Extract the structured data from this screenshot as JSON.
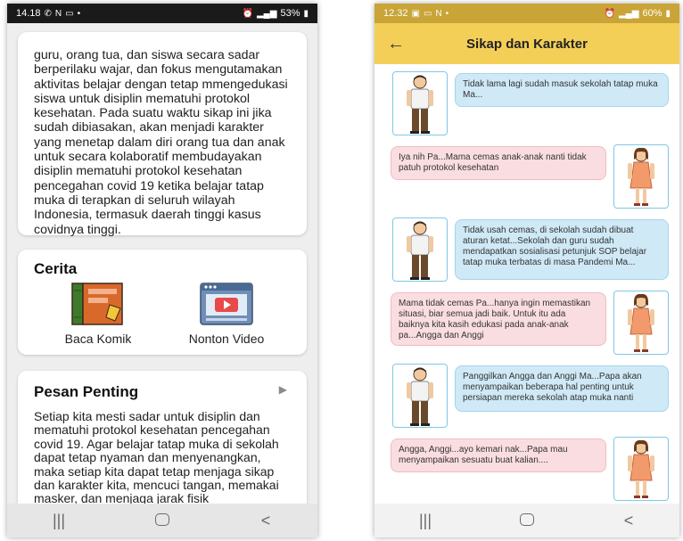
{
  "left_screen": {
    "status_bar": {
      "time": "14.18",
      "battery": "53%"
    },
    "intro_card": {
      "text": "guru, orang tua, dan siswa secara sadar berperilaku wajar, dan fokus mengutamakan aktivitas belajar dengan tetap mmengedukasi siswa untuk disiplin mematuhi protokol kesehatan. Pada suatu waktu sikap ini jika sudah dibiasakan, akan menjadi karakter yang menetap dalam diri orang tua dan anak untuk secara kolaboratif membudayakan disiplin mematuhi protokol kesehatan pencegahan covid 19 ketika belajar tatap muka di terapkan di seluruh wilayah Indonesia, termasuk daerah tinggi kasus covidnya tinggi."
    },
    "story_card": {
      "heading": "Cerita",
      "items": [
        {
          "label": "Baca Komik",
          "icon": "comic-book-icon"
        },
        {
          "label": "Nonton Video",
          "icon": "video-player-icon"
        }
      ]
    },
    "message_card": {
      "heading": "Pesan Penting",
      "text": "Setiap kita mesti sadar untuk disiplin dan mematuhi protokol kesehatan pencegahan covid 19. Agar belajar tatap muka di sekolah dapat tetap nyaman dan menyenangkan, maka setiap kita dapat tetap menjaga sikap dan karakter kita, mencuci tangan, memakai masker, dan menjaga jarak fisik"
    }
  },
  "right_screen": {
    "status_bar": {
      "time": "12.32",
      "battery": "60%"
    },
    "app_bar": {
      "title": "Sikap dan Karakter"
    },
    "messages": [
      {
        "speaker": "father",
        "text": "Tidak lama lagi sudah masuk sekolah tatap muka Ma..."
      },
      {
        "speaker": "mother",
        "text": "Iya nih Pa...Mama cemas anak-anak nanti tidak patuh protokol kesehatan"
      },
      {
        "speaker": "father",
        "text": "Tidak usah cemas, di sekolah sudah dibuat aturan ketat...Sekolah dan guru sudah mendapatkan sosialisasi petunjuk SOP belajar tatap muka terbatas di masa Pandemi Ma..."
      },
      {
        "speaker": "mother",
        "text": "Mama tidak cemas Pa...hanya ingin memastikan situasi, biar semua jadi baik. Untuk itu ada baiknya kita kasih edukasi pada anak-anak pa...Angga dan Anggi"
      },
      {
        "speaker": "father",
        "text": "Panggilkan Angga dan Anggi Ma...Papa akan menyampaikan beberapa hal penting untuk persiapan mereka sekolah atap muka nanti"
      },
      {
        "speaker": "mother",
        "text": "Angga, Anggi...ayo kemari nak...Papa mau menyampaikan sesuatu buat kalian...."
      }
    ]
  },
  "colors": {
    "app_bar": "#f4cf58",
    "male_bubble": "#cfe9f6",
    "female_bubble": "#fadde0",
    "avatar_border": "#7fc8e6"
  }
}
